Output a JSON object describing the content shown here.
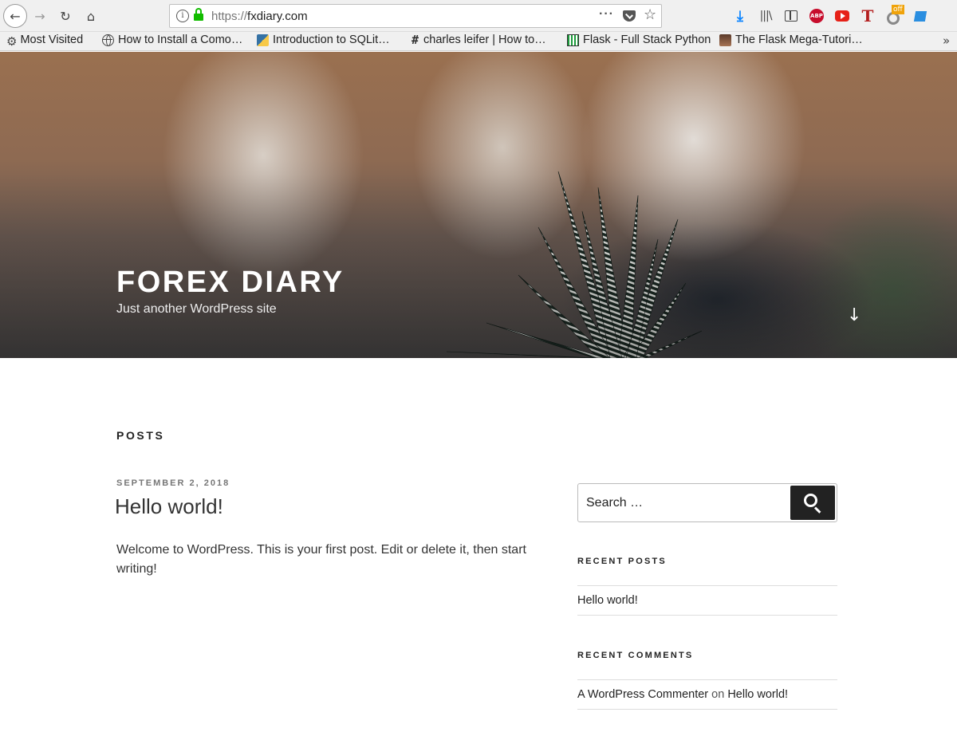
{
  "browser": {
    "url_scheme": "https://",
    "url_host": "fxdiary.com",
    "bookmarks": [
      {
        "label": "Most Visited",
        "icon": "gear-icon"
      },
      {
        "label": "How to Install a Como…",
        "icon": "globe-icon"
      },
      {
        "label": "Introduction to SQLit…",
        "icon": "python-icon"
      },
      {
        "label": "charles leifer | How to…",
        "icon": "hash-icon"
      },
      {
        "label": "Flask - Full Stack Python",
        "icon": "flask-icon"
      },
      {
        "label": "The Flask Mega-Tutori…",
        "icon": "mega-tutorial-icon"
      }
    ],
    "extension_badge": "off",
    "abp_label": "ABP",
    "t_label": "T"
  },
  "site": {
    "title": "FOREX DIARY",
    "description": "Just another WordPress site"
  },
  "content": {
    "heading": "POSTS",
    "post": {
      "date": "SEPTEMBER 2, 2018",
      "title": "Hello world!",
      "excerpt": "Welcome to WordPress. This is your first post. Edit or delete it, then start writing!"
    }
  },
  "sidebar": {
    "search_placeholder": "Search …",
    "recent_posts_title": "RECENT POSTS",
    "recent_posts": [
      "Hello world!"
    ],
    "recent_comments_title": "RECENT COMMENTS",
    "recent_comment": {
      "author": "A WordPress Commenter",
      "on": "on",
      "post": "Hello world!"
    }
  },
  "colors": {
    "lock_green": "#12bc00",
    "download_blue": "#0a84ff",
    "search_button": "#222222"
  }
}
